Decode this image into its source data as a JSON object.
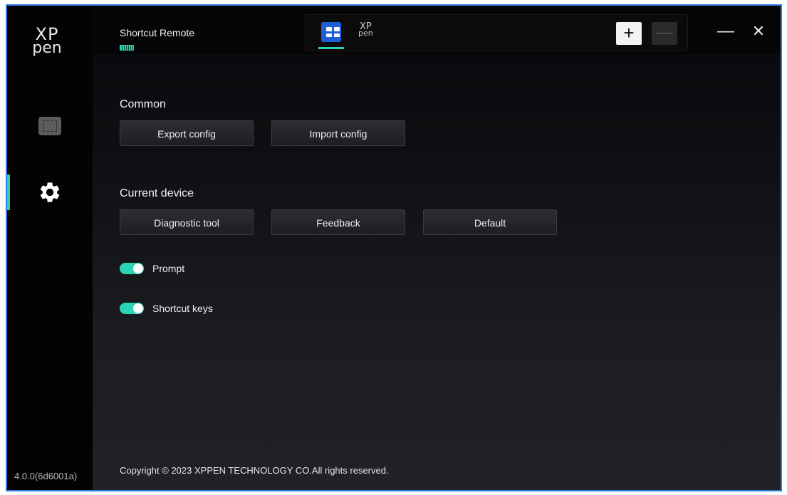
{
  "app": {
    "logo_line1": "XP",
    "logo_line2": "pen",
    "version": "4.0.0(6d6001a)"
  },
  "device": {
    "name": "Shortcut Remote",
    "battery_color": "#2ad4b3",
    "tile_logo_line1": "XP",
    "tile_logo_line2": "pen"
  },
  "toolbar": {
    "add_label": "+",
    "remove_label": "—",
    "minimize_label": "—",
    "close_label": "✕"
  },
  "sidebar": {
    "items": [
      {
        "name": "screen",
        "icon": "screen-icon",
        "active": false
      },
      {
        "name": "settings",
        "icon": "gear-icon",
        "active": true
      }
    ]
  },
  "common": {
    "title": "Common",
    "export_label": "Export config",
    "import_label": "Import config"
  },
  "current_device": {
    "title": "Current device",
    "diagnostic_label": "Diagnostic tool",
    "feedback_label": "Feedback",
    "default_label": "Default"
  },
  "toggles": {
    "prompt": {
      "label": "Prompt",
      "on": true
    },
    "shortcut_keys": {
      "label": "Shortcut keys",
      "on": true
    }
  },
  "footer": {
    "copyright": "Copyright © 2023  XPPEN TECHNOLOGY CO.All rights reserved."
  },
  "colors": {
    "accent": "#2ad4b3",
    "tile": "#1f5fd6",
    "window_border": "#2f7de1"
  }
}
